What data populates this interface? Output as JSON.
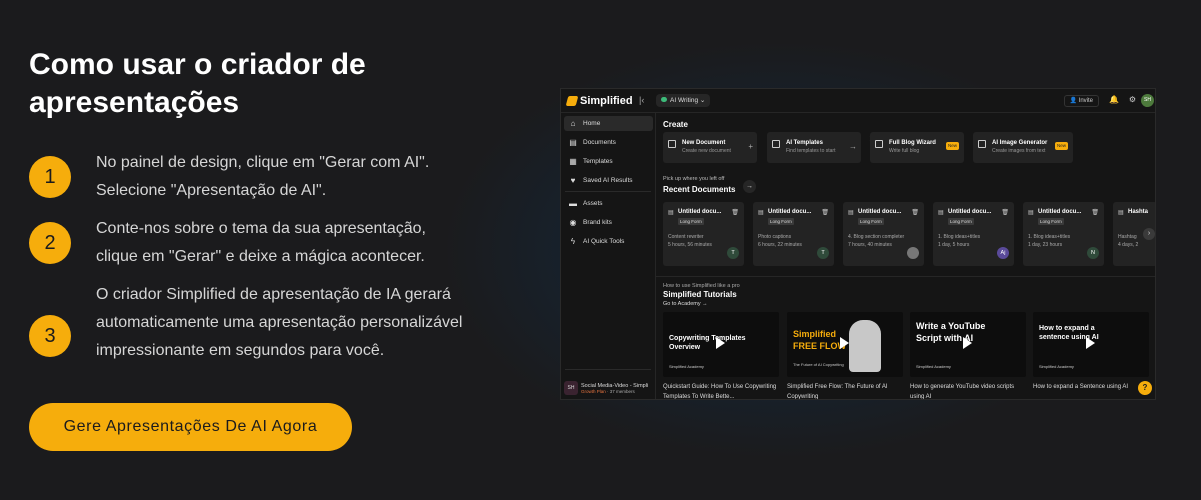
{
  "headline": "Como usar o criador de apresentações",
  "steps": [
    {
      "num": "1",
      "text": "No painel de design, clique em \"Gerar com AI\". Selecione \"Apresentação de AI\"."
    },
    {
      "num": "2",
      "text": "Conte-nos sobre o tema da sua apresentação, clique em \"Gerar\" e deixe a mágica acontecer."
    },
    {
      "num": "3",
      "text": "O criador Simplified de apresentação de IA gerará automaticamente uma apresentação personalizável impressionante em segundos para você."
    }
  ],
  "cta_label": "Gere Apresentações De AI Agora",
  "colors": {
    "accent": "#f6ad0c",
    "background": "#1b1b1d"
  },
  "app": {
    "logo": "Simplified",
    "ai_writing": "AI Writing",
    "invite": "Invite",
    "avatar": "SH",
    "sidebar": [
      {
        "icon": "home-icon",
        "glyph": "⌂",
        "label": "Home"
      },
      {
        "icon": "document-icon",
        "glyph": "▤",
        "label": "Documents"
      },
      {
        "icon": "templates-icon",
        "glyph": "▦",
        "label": "Templates"
      },
      {
        "icon": "heart-icon",
        "glyph": "♥",
        "label": "Saved AI Results"
      },
      {
        "icon": "folder-icon",
        "glyph": "▬",
        "label": "Assets"
      },
      {
        "icon": "palette-icon",
        "glyph": "◉",
        "label": "Brand kits"
      },
      {
        "icon": "bolt-icon",
        "glyph": "ϟ",
        "label": "AI Quick Tools"
      }
    ],
    "workspace": {
      "badge": "SH",
      "name": "Social Media-Video - Simpli",
      "plan": "Growth Plan",
      "members": "· 37 members"
    },
    "create_heading": "Create",
    "create_cards": [
      {
        "title": "New Document",
        "subtitle": "Create new document"
      },
      {
        "title": "AI Templates",
        "subtitle": "Find templates to start"
      },
      {
        "title": "Full Blog Wizard",
        "subtitle": "Write full blog",
        "badge": "New"
      },
      {
        "title": "AI Image Generator",
        "subtitle": "Create images from text",
        "badge": "New"
      }
    ],
    "pick_up": "Pick up where you left off",
    "recent_heading": "Recent Documents",
    "recent_docs": [
      {
        "title": "Untitled docu...",
        "tag": "Long Form",
        "line1": "Content rewriter",
        "line2": "5 hours, 56 minutes",
        "avatar": "T"
      },
      {
        "title": "Untitled docu...",
        "tag": "Long Form",
        "line1": "Photo captions",
        "line2": "6 hours, 22 minutes",
        "avatar": "T"
      },
      {
        "title": "Untitled docu...",
        "tag": "Long Form",
        "line1": "4. Blog section completer",
        "line2": "7 hours, 40 minutes",
        "avatar": ""
      },
      {
        "title": "Untitled docu...",
        "tag": "Long Form",
        "line1": "1. Blog ideas+titles",
        "line2": "1 day, 5 hours",
        "avatar": "Aj"
      },
      {
        "title": "Untitled docu...",
        "tag": "Long Form",
        "line1": "1. Blog ideas+titles",
        "line2": "1 day, 23 hours",
        "avatar": "N"
      },
      {
        "title": "Hashta",
        "tag": "",
        "line1": "Hashtag",
        "line2": "4 days, 2",
        "avatar": ""
      }
    ],
    "how_to": "How to use Simplified like a pro",
    "tutorials_heading": "Simplified Tutorials",
    "academy_link": "Go to Academy",
    "videos": [
      {
        "thumb_title": "Copywriting Templates Overview",
        "brand": "Simplified Academy",
        "caption": "Quickstart Guide: How To Use Copywriting Templates To Write Bette..."
      },
      {
        "thumb_title": "Simplified FREE FLOW",
        "thumb_sub": "The Future of AI Copywriting",
        "caption": "Simplified Free Flow: The Future of AI Copywriting"
      },
      {
        "thumb_title": "Write a YouTube Script with AI",
        "brand": "Simplified Academy",
        "caption": "How to generate YouTube video scripts using AI"
      },
      {
        "thumb_title": "How to expand a sentence using AI",
        "brand": "Simplified Academy",
        "caption": "How to expand a Sentence using AI"
      }
    ],
    "help": "?"
  }
}
